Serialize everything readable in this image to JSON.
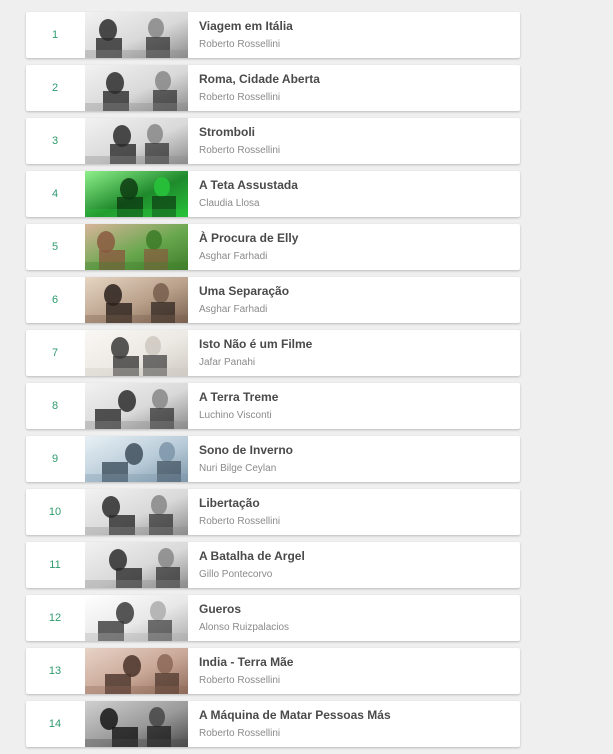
{
  "films": [
    {
      "rank": "1",
      "title": "Viagem em Itália",
      "director": "Roberto Rossellini",
      "tone": "bw"
    },
    {
      "rank": "2",
      "title": "Roma, Cidade Aberta",
      "director": "Roberto Rossellini",
      "tone": "bw"
    },
    {
      "rank": "3",
      "title": "Stromboli",
      "director": "Roberto Rossellini",
      "tone": "bw"
    },
    {
      "rank": "4",
      "title": "A Teta Assustada",
      "director": "Claudia Llosa",
      "tone": "green"
    },
    {
      "rank": "5",
      "title": "À Procura de Elly",
      "director": "Asghar Farhadi",
      "tone": "greenwarm"
    },
    {
      "rank": "6",
      "title": "Uma Separação",
      "director": "Asghar Farhadi",
      "tone": "warm"
    },
    {
      "rank": "7",
      "title": "Isto Não é um Filme",
      "director": "Jafar Panahi",
      "tone": "light"
    },
    {
      "rank": "8",
      "title": "A Terra Treme",
      "director": "Luchino Visconti",
      "tone": "bw"
    },
    {
      "rank": "9",
      "title": "Sono de Inverno",
      "director": "Nuri Bilge Ceylan",
      "tone": "snow"
    },
    {
      "rank": "10",
      "title": "Libertação",
      "director": "Roberto Rossellini",
      "tone": "bw"
    },
    {
      "rank": "11",
      "title": "A Batalha de Argel",
      "director": "Gillo Pontecorvo",
      "tone": "bw"
    },
    {
      "rank": "12",
      "title": "Gueros",
      "director": "Alonso Ruizpalacios",
      "tone": "bwlight"
    },
    {
      "rank": "13",
      "title": "India - Terra Mãe",
      "director": "Roberto Rossellini",
      "tone": "sepia"
    },
    {
      "rank": "14",
      "title": "A Máquina de Matar Pessoas Más",
      "director": "Roberto Rossellini",
      "tone": "bwdark"
    }
  ]
}
